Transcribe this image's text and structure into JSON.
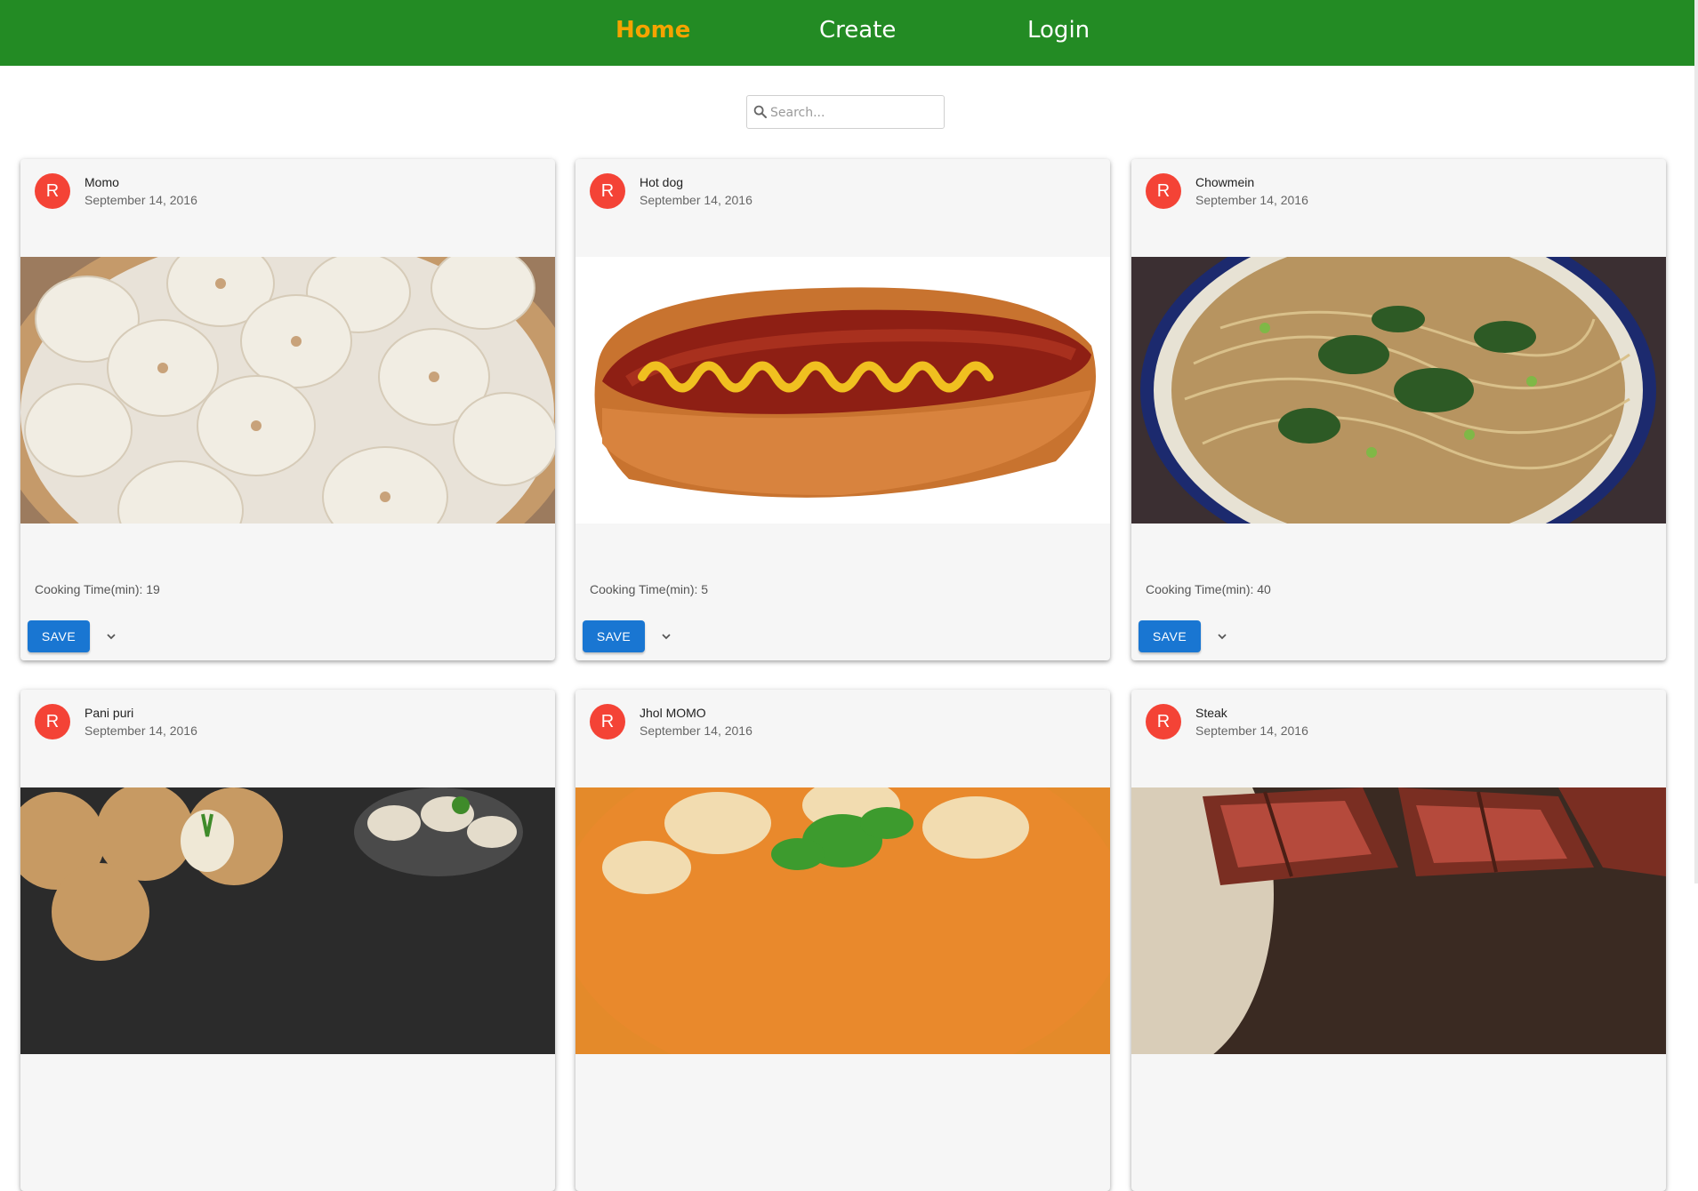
{
  "nav": {
    "items": [
      {
        "label": "Home",
        "active": true
      },
      {
        "label": "Create",
        "active": false
      },
      {
        "label": "Login",
        "active": false
      }
    ],
    "background": "#238b24",
    "active_color": "#f5a300"
  },
  "search": {
    "placeholder": "Search...",
    "value": "",
    "icon": "search-icon"
  },
  "cards": [
    {
      "avatar": "R",
      "title": "Momo",
      "date": "September 14, 2016",
      "cooking_time": "Cooking Time(min): 19",
      "save_label": "SAVE",
      "image": "momo-dumplings-photo"
    },
    {
      "avatar": "R",
      "title": "Hot dog",
      "date": "September 14, 2016",
      "cooking_time": "Cooking Time(min): 5",
      "save_label": "SAVE",
      "image": "hot-dog-photo"
    },
    {
      "avatar": "R",
      "title": "Chowmein",
      "date": "September 14, 2016",
      "cooking_time": "Cooking Time(min): 40",
      "save_label": "SAVE",
      "image": "chowmein-noodles-photo"
    },
    {
      "avatar": "R",
      "title": "Pani puri",
      "date": "September 14, 2016",
      "image": "pani-puri-photo"
    },
    {
      "avatar": "R",
      "title": "Jhol MOMO",
      "date": "September 14, 2016",
      "image": "jhol-momo-photo"
    },
    {
      "avatar": "R",
      "title": "Steak",
      "date": "September 14, 2016",
      "image": "steak-photo"
    }
  ],
  "colors": {
    "avatar": "#f44336",
    "save_button": "#1976d2",
    "card_background": "#f6f6f6"
  }
}
